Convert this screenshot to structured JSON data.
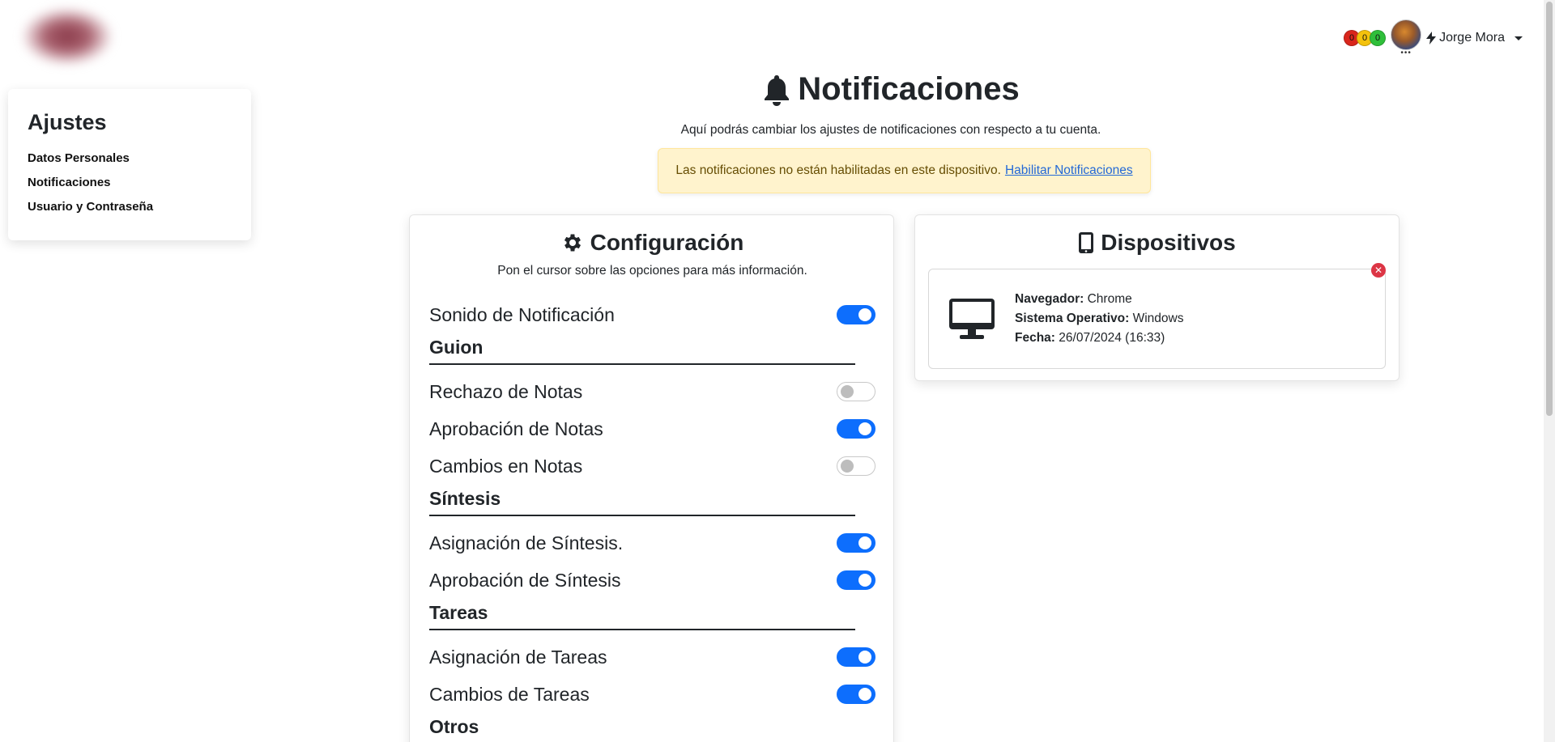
{
  "brand": {
    "logo_icon": "blurred-logo"
  },
  "topbar": {
    "counters": [
      {
        "value": "0",
        "color": "#d9261c"
      },
      {
        "value": "0",
        "color": "#f4c20d"
      },
      {
        "value": "0",
        "color": "#2fbf3a"
      }
    ],
    "avatar_dots": "•••",
    "user_icon": "bolt-icon",
    "username": "Jorge Mora"
  },
  "sidebar": {
    "title": "Ajustes",
    "items": [
      {
        "label": "Datos Personales"
      },
      {
        "label": "Notificaciones"
      },
      {
        "label": "Usuario y Contraseña"
      }
    ]
  },
  "header": {
    "title": "Notificaciones",
    "icon": "bell-icon",
    "subtitle": "Aquí podrás cambiar los ajustes de notificaciones con respecto a tu cuenta."
  },
  "alert": {
    "text": "Las notificaciones no están habilitadas en este dispositivo.",
    "link": "Habilitar Notificaciones"
  },
  "config": {
    "title": "Configuración",
    "icon": "gear-icon",
    "subtitle": "Pon el cursor sobre las opciones para más información.",
    "sound": {
      "label": "Sonido de Notificación",
      "on": true
    },
    "sections": [
      {
        "title": "Guion",
        "items": [
          {
            "label": "Rechazo de Notas",
            "on": false
          },
          {
            "label": "Aprobación de Notas",
            "on": true
          },
          {
            "label": "Cambios en Notas",
            "on": false
          }
        ]
      },
      {
        "title": "Síntesis",
        "items": [
          {
            "label": "Asignación de Síntesis.",
            "on": true
          },
          {
            "label": "Aprobación de Síntesis",
            "on": true
          }
        ]
      },
      {
        "title": "Tareas",
        "items": [
          {
            "label": "Asignación de Tareas",
            "on": true
          },
          {
            "label": "Cambios de Tareas",
            "on": true
          }
        ]
      },
      {
        "title": "Otros",
        "items": []
      }
    ]
  },
  "devices": {
    "title": "Dispositivos",
    "icon": "mobile-icon",
    "list": [
      {
        "icon": "desktop-icon",
        "browser_label": "Navegador:",
        "browser": "Chrome",
        "os_label": "Sistema Operativo:",
        "os": "Windows",
        "date_label": "Fecha:",
        "date": "26/07/2024 (16:33)",
        "remove_icon": "close-icon"
      }
    ]
  },
  "colors": {
    "primary": "#0d6efd",
    "alert_bg": "#fff3cd",
    "alert_text": "#664d03",
    "danger": "#dc3545"
  }
}
